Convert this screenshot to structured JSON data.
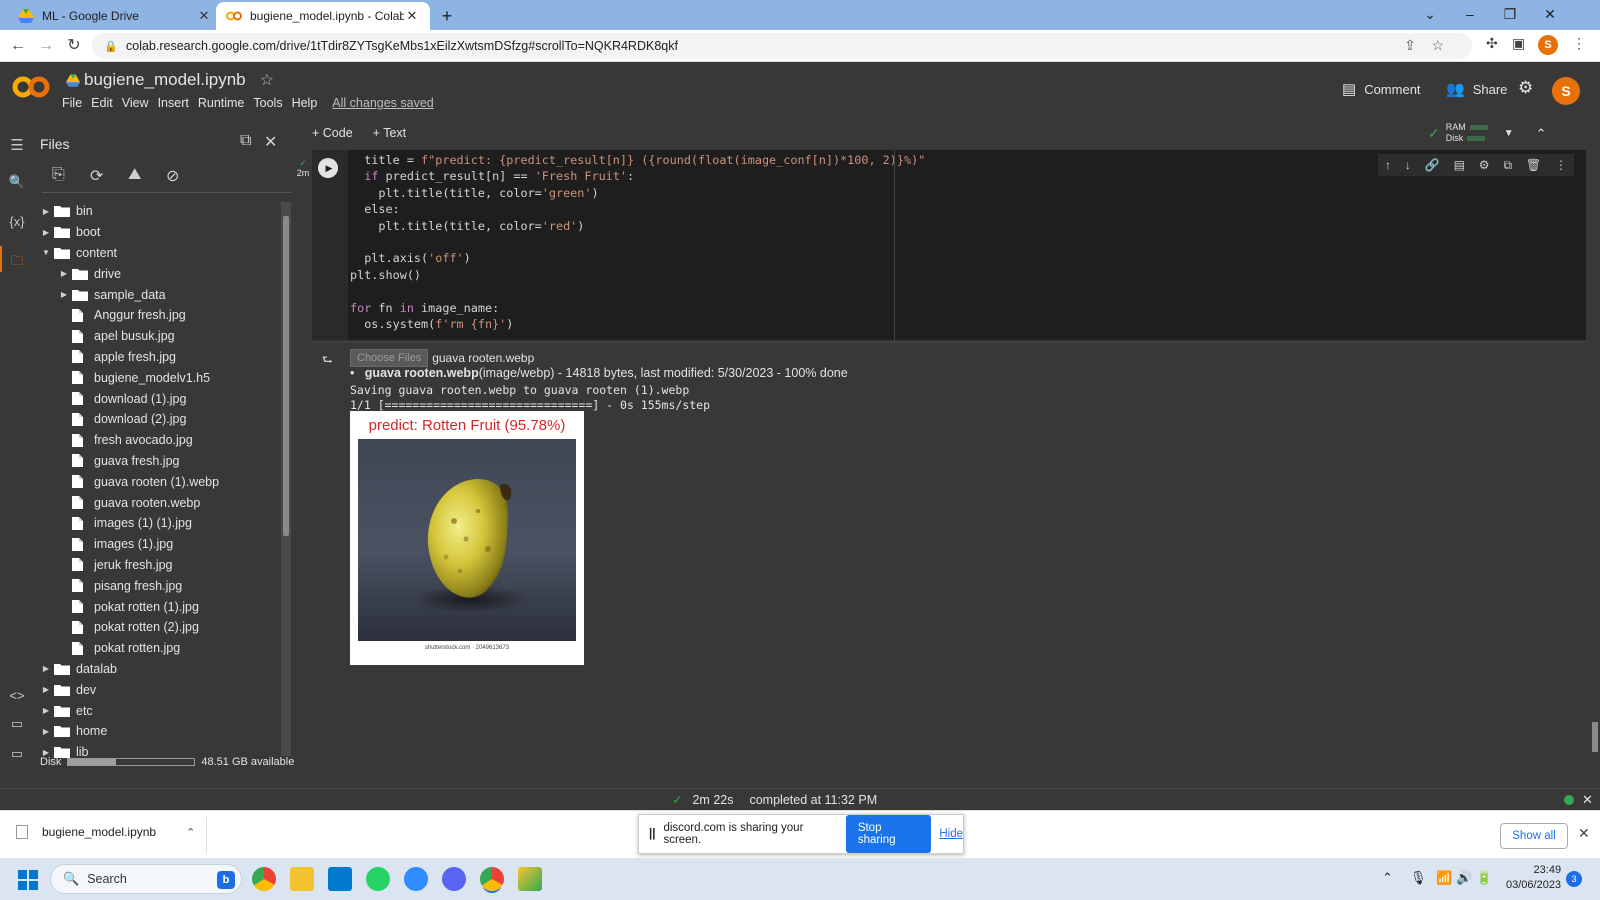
{
  "browser": {
    "tabs": [
      {
        "title": "ML - Google Drive",
        "active": false
      },
      {
        "title": "bugiene_model.ipynb - Colabora",
        "active": true
      }
    ],
    "url": "colab.research.google.com/drive/1tTdir8ZYTsgKeMbs1xEilzXwtsmDSfzg#scrollTo=NQKR4RDK8qkf",
    "profile_initial": "S"
  },
  "colab": {
    "logo": "CO",
    "notebook_title": "bugiene_model.ipynb",
    "menu": [
      "File",
      "Edit",
      "View",
      "Insert",
      "Runtime",
      "Tools",
      "Help"
    ],
    "save_status": "All changes saved",
    "comment_label": "Comment",
    "share_label": "Share",
    "user_initial": "S",
    "add_code_label": "+ Code",
    "add_text_label": "+ Text",
    "ram_label": "RAM",
    "disk_label": "Disk"
  },
  "files_panel": {
    "title": "Files",
    "tree": [
      {
        "name": "bin",
        "type": "folder",
        "depth": 0,
        "expanded": false
      },
      {
        "name": "boot",
        "type": "folder",
        "depth": 0,
        "expanded": false
      },
      {
        "name": "content",
        "type": "folder",
        "depth": 0,
        "expanded": true
      },
      {
        "name": "drive",
        "type": "folder",
        "depth": 1,
        "expanded": false
      },
      {
        "name": "sample_data",
        "type": "folder",
        "depth": 1,
        "expanded": false
      },
      {
        "name": "Anggur fresh.jpg",
        "type": "file",
        "depth": 1
      },
      {
        "name": "apel busuk.jpg",
        "type": "file",
        "depth": 1
      },
      {
        "name": "apple fresh.jpg",
        "type": "file",
        "depth": 1
      },
      {
        "name": "bugiene_modelv1.h5",
        "type": "file",
        "depth": 1
      },
      {
        "name": "download (1).jpg",
        "type": "file",
        "depth": 1
      },
      {
        "name": "download (2).jpg",
        "type": "file",
        "depth": 1
      },
      {
        "name": "fresh avocado.jpg",
        "type": "file",
        "depth": 1
      },
      {
        "name": "guava fresh.jpg",
        "type": "file",
        "depth": 1
      },
      {
        "name": "guava rooten (1).webp",
        "type": "file",
        "depth": 1
      },
      {
        "name": "guava rooten.webp",
        "type": "file",
        "depth": 1
      },
      {
        "name": "images (1) (1).jpg",
        "type": "file",
        "depth": 1
      },
      {
        "name": "images (1).jpg",
        "type": "file",
        "depth": 1
      },
      {
        "name": "jeruk fresh.jpg",
        "type": "file",
        "depth": 1
      },
      {
        "name": "pisang fresh.jpg",
        "type": "file",
        "depth": 1
      },
      {
        "name": "pokat rotten (1).jpg",
        "type": "file",
        "depth": 1
      },
      {
        "name": "pokat rotten (2).jpg",
        "type": "file",
        "depth": 1
      },
      {
        "name": "pokat rotten.jpg",
        "type": "file",
        "depth": 1
      },
      {
        "name": "datalab",
        "type": "folder",
        "depth": 0,
        "expanded": false
      },
      {
        "name": "dev",
        "type": "folder",
        "depth": 0,
        "expanded": false
      },
      {
        "name": "etc",
        "type": "folder",
        "depth": 0,
        "expanded": false
      },
      {
        "name": "home",
        "type": "folder",
        "depth": 0,
        "expanded": false
      },
      {
        "name": "lib",
        "type": "folder",
        "depth": 0,
        "expanded": false
      }
    ],
    "disk_label": "Disk",
    "disk_used_fraction": 0.38,
    "disk_available": "48.51 GB available"
  },
  "cell": {
    "exec_time_badge": "2m",
    "code_lines": [
      "  title = f\"predict: {predict_result[n]} ({round(float(image_conf[n])*100, 2)}%)\"",
      "  if predict_result[n] == 'Fresh Fruit':",
      "    plt.title(title, color='green')",
      "  else:",
      "    plt.title(title, color='red')",
      "",
      "  plt.axis('off')",
      "plt.show()",
      "",
      "for fn in image_name:",
      "  os.system(f'rm {fn}')"
    ],
    "output": {
      "choose_files_label": "Choose Files",
      "chosen_file": "guava rooten.webp",
      "upload_bold": "guava rooten.webp",
      "upload_detail": "(image/webp) - 14818 bytes, last modified: 5/30/2023 - 100% done",
      "saving_line": "Saving guava rooten.webp to guava rooten (1).webp",
      "progress_line": "1/1 [==============================] - 0s 155ms/step",
      "plot_title": "predict: Rotten Fruit (95.78%)",
      "plot_title_color": "#d62728",
      "image_caption": "shutterstock.com · 2049613673"
    }
  },
  "statusbar": {
    "duration": "2m 22s",
    "completed": "completed at 11:32 PM"
  },
  "downloads": {
    "file": "bugiene_model.ipynb",
    "show_all": "Show all"
  },
  "screen_share": {
    "message": "discord.com is sharing your screen.",
    "stop": "Stop sharing",
    "hide": "Hide"
  },
  "taskbar": {
    "search_placeholder": "Search",
    "time": "23:49",
    "date": "03/06/2023",
    "notifications": "3"
  },
  "colors": {
    "accent": "#e8710a",
    "colab_bg": "#383838",
    "code_bg": "#1e1e1e",
    "success": "#34a853",
    "link": "#1a73e8"
  }
}
